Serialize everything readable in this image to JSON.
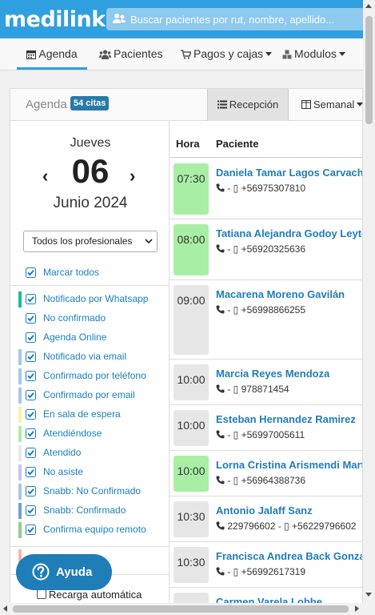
{
  "brand": {
    "name": "medilink"
  },
  "search": {
    "placeholder": "Buscar pacientes por rut, nombre, apellido..."
  },
  "nav": [
    {
      "label": "Agenda",
      "icon": "calendar-icon",
      "active": true
    },
    {
      "label": "Pacientes",
      "icon": "users-icon"
    },
    {
      "label": "Pagos y cajas",
      "icon": "cart-icon",
      "dropdown": true
    },
    {
      "label": "Modulos",
      "icon": "cubes-icon",
      "dropdown": true
    }
  ],
  "agenda": {
    "title": "Agenda",
    "count_badge": "54 citas",
    "views": [
      {
        "label": "Recepción",
        "icon": "list-icon",
        "active": true
      },
      {
        "label": "Semanal",
        "icon": "columns-icon",
        "dropdown": true
      }
    ]
  },
  "date": {
    "day_of_week": "Jueves",
    "day": "06",
    "month_year": "Junio 2024",
    "prev": "‹",
    "next": "›"
  },
  "professional_filter": {
    "selected": "Todos los profesionales"
  },
  "filters": {
    "mark_all": "Marcar todos",
    "items": [
      {
        "label": "Notificado por Whatsapp",
        "color": "#1abc9c"
      },
      {
        "label": "No confirmado",
        "color": ""
      },
      {
        "label": "Agenda Online",
        "color": ""
      },
      {
        "label": "Notificado via email",
        "color": "#a9c6ea"
      },
      {
        "label": "Confirmado por teléfono",
        "color": "#a9c6ea"
      },
      {
        "label": "Confirmado por email",
        "color": "#a9c6ea"
      },
      {
        "label": "En sala de espera",
        "color": "#f8f3a6"
      },
      {
        "label": "Atendiéndose",
        "color": "#a8efa5"
      },
      {
        "label": "Atendido",
        "color": "#e8e8e8"
      },
      {
        "label": "No asiste",
        "color": "#c9c3f0"
      },
      {
        "label": "Snabb: No Confirmado",
        "color": "#a9c6ea"
      },
      {
        "label": "Snabb: Confirmado",
        "color": "#6fa0d8"
      },
      {
        "label": "Confirma equipo remoto",
        "color": "#8fcf8a"
      }
    ]
  },
  "auto_reload": {
    "label": "Recarga automática",
    "checked": false
  },
  "help": {
    "label": "Ayuda"
  },
  "table": {
    "headers": {
      "time": "Hora",
      "patient": "Paciente"
    },
    "rows": [
      {
        "time": "07:30",
        "name": "Daniela Tamar Lagos Carvacho",
        "phones": "- ▯ +56975307810",
        "color": "#a8efa5"
      },
      {
        "time": "08:00",
        "name": "Tatiana Alejandra Godoy Leyton",
        "phones": "- ▯ +56920325636",
        "color": "#a8efa5"
      },
      {
        "time": "09:00",
        "name": "Macarena Moreno Gavilán",
        "phones": "- ▯ +56998866255",
        "color": "#e6e6e6"
      },
      {
        "time": "10:00",
        "name": "Marcia Reyes Mendoza",
        "phones": "- ▯ 978871454",
        "color": "#e6e6e6"
      },
      {
        "time": "10:00",
        "name": "Esteban Hernandez Ramirez",
        "phones": "- ▯ +56997005611",
        "color": "#e6e6e6"
      },
      {
        "time": "10:00",
        "name": "Lorna Cristina Arismendi Martinez",
        "phones": "- ▯ +56964388736",
        "color": "#a8efa5"
      },
      {
        "time": "10:30",
        "name": "Antonio Jalaff Sanz",
        "phones": "229796602 - ▯ +56229796602",
        "color": "#e6e6e6"
      },
      {
        "time": "10:30",
        "name": "Francisca Andrea Back Gonzalez",
        "phones": "- ▯ +56992617319",
        "color": "#e6e6e6"
      },
      {
        "time": "10:30",
        "name": "Carmen Varela Lobbe",
        "phones": "",
        "color": "#e6e6e6"
      }
    ]
  }
}
